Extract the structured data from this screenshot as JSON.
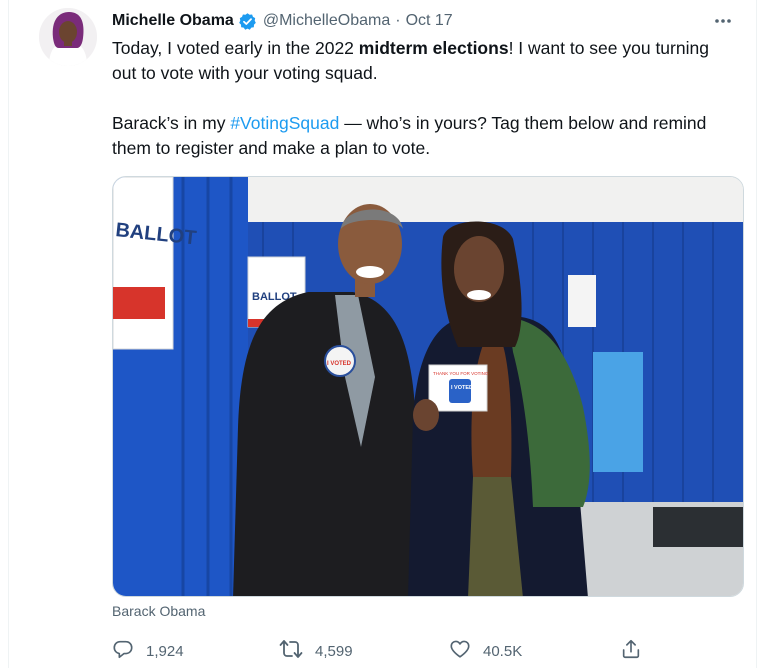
{
  "tweet": {
    "author_name": "Michelle Obama",
    "handle": "@MichelleObama",
    "separator": "·",
    "date": "Oct 17",
    "text_line1_part1": "Today, I voted early in the 2022 ",
    "text_line1_bold": "midterm elections",
    "text_line1_part2": "! I want to see you turning out to vote with your voting squad.",
    "text_line2_part1": "Barack’s in my ",
    "hashtag": "#VotingSquad",
    "text_line2_part2": " — who’s in yours? Tag them below and remind them to register and make a plan to vote.",
    "media_caption": "Barack Obama",
    "photo_signs": {
      "ballot_large": "BALLOT",
      "ballot_small": "BALLOT",
      "sticker_top": "THANK YOU FOR VOTING",
      "sticker_main": "I VOTED",
      "pin": "I VOTED"
    }
  },
  "actions": {
    "replies": "1,924",
    "retweets": "4,599",
    "likes": "40.5K"
  },
  "icons": {
    "verified": "verified-badge-icon",
    "more": "more-dots-icon",
    "reply": "reply-icon",
    "retweet": "retweet-icon",
    "like": "heart-icon",
    "share": "share-icon"
  },
  "colors": {
    "link": "#1d9bf0",
    "secondary_text": "#536471",
    "primary_text": "#0f1419",
    "curtain_blue": "#1e4fb8"
  }
}
